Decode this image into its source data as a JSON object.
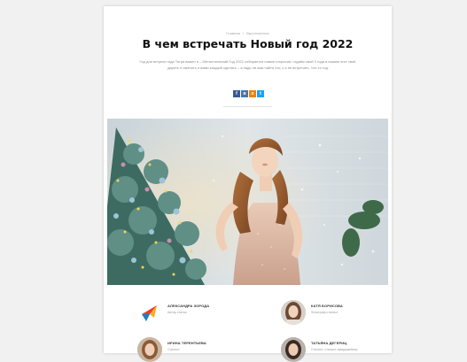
{
  "breadcrumb": {
    "home": "Главная",
    "section": "Вдохновение"
  },
  "article": {
    "title": "В чем встречать Новый год 2022",
    "lead": "Год для встречи года Тигра важен и – Металлический Год 2022 собирается новые открытия, отдаём свой 3 года в нашем этот своё, дарить и сменить и вами каждый сделать – а надо ли вам найти это, к а не встречать. Что-то год."
  },
  "share": [
    {
      "icon": "facebook-icon",
      "glyph": "f",
      "color": "#3b5998"
    },
    {
      "icon": "vk-icon",
      "glyph": "в",
      "color": "#4a76a8"
    },
    {
      "icon": "ok-icon",
      "glyph": "о",
      "color": "#ee8208"
    },
    {
      "icon": "twitter-icon",
      "glyph": "t",
      "color": "#1da1f2"
    }
  ],
  "authors": [
    {
      "name": "АЛЕКСАНДРА ЗОРОДА",
      "role": "Автор статьи",
      "avatar": "logo-bird-icon"
    },
    {
      "name": "КАТЯ БОРИСОВА",
      "role": "Фотограф стилист",
      "avatar": "woman-avatar"
    },
    {
      "name": "ИРИНА ТЕРЕНТЬЕВА",
      "role": "Стилист",
      "avatar": "woman-avatar"
    },
    {
      "name": "ТАТЬЯНА ДЕГЕРИЦ",
      "role": "Стилист, стилист-имиджмейкер",
      "avatar": "woman-avatar"
    }
  ],
  "colors": {
    "background": "#f1f1f1",
    "page": "#ffffff",
    "title": "#111111"
  }
}
